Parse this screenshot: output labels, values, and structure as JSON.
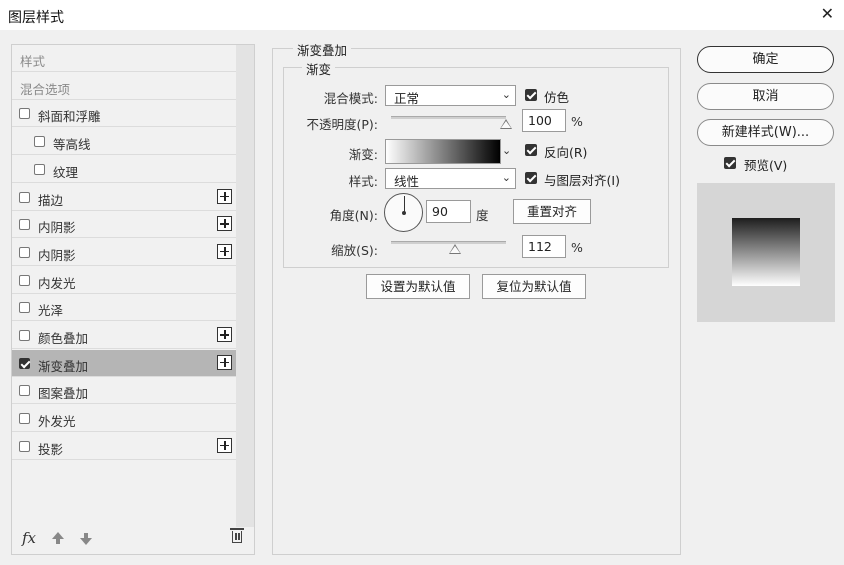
{
  "window": {
    "title": "图层样式"
  },
  "left_list": {
    "items": [
      {
        "label": "样式",
        "checkbox": false,
        "checked": false,
        "plus": false,
        "grey": true,
        "indent": 0
      },
      {
        "label": "混合选项",
        "checkbox": false,
        "checked": false,
        "plus": false,
        "grey": true,
        "indent": 0
      },
      {
        "label": "斜面和浮雕",
        "checkbox": true,
        "checked": false,
        "plus": false,
        "grey": false,
        "indent": 0
      },
      {
        "label": "等高线",
        "checkbox": true,
        "checked": false,
        "plus": false,
        "grey": false,
        "indent": 1
      },
      {
        "label": "纹理",
        "checkbox": true,
        "checked": false,
        "plus": false,
        "grey": false,
        "indent": 1
      },
      {
        "label": "描边",
        "checkbox": true,
        "checked": false,
        "plus": true,
        "grey": false,
        "indent": 0
      },
      {
        "label": "内阴影",
        "checkbox": true,
        "checked": false,
        "plus": true,
        "grey": false,
        "indent": 0
      },
      {
        "label": "内阴影",
        "checkbox": true,
        "checked": false,
        "plus": true,
        "grey": false,
        "indent": 0
      },
      {
        "label": "内发光",
        "checkbox": true,
        "checked": false,
        "plus": false,
        "grey": false,
        "indent": 0
      },
      {
        "label": "光泽",
        "checkbox": true,
        "checked": false,
        "plus": false,
        "grey": false,
        "indent": 0
      },
      {
        "label": "颜色叠加",
        "checkbox": true,
        "checked": false,
        "plus": true,
        "grey": false,
        "indent": 0
      },
      {
        "label": "渐变叠加",
        "checkbox": true,
        "checked": true,
        "plus": true,
        "grey": false,
        "indent": 0,
        "selected": true
      },
      {
        "label": "图案叠加",
        "checkbox": true,
        "checked": false,
        "plus": false,
        "grey": false,
        "indent": 0
      },
      {
        "label": "外发光",
        "checkbox": true,
        "checked": false,
        "plus": false,
        "grey": false,
        "indent": 0
      },
      {
        "label": "投影",
        "checkbox": true,
        "checked": false,
        "plus": true,
        "grey": false,
        "indent": 0
      }
    ],
    "fx_label": "fx"
  },
  "gradient_overlay": {
    "section_title": "渐变叠加",
    "group_title": "渐变",
    "blend_mode_label": "混合模式:",
    "blend_mode_value": "正常",
    "dither_label": "仿色",
    "opacity_label": "不透明度(P):",
    "opacity_value": "100",
    "opacity_unit": "%",
    "opacity_level": 1.0,
    "gradient_label": "渐变:",
    "reverse_label": "反向(R)",
    "style_label": "样式:",
    "style_value": "线性",
    "align_label": "与图层对齐(I)",
    "angle_label": "角度(N):",
    "angle_value": "90",
    "angle_unit": "度",
    "reset_align_button": "重置对齐",
    "scale_label": "缩放(S):",
    "scale_value": "112",
    "scale_unit": "%",
    "scale_level": 0.56,
    "set_default_button": "设置为默认值",
    "reset_default_button": "复位为默认值"
  },
  "right": {
    "ok_button": "确定",
    "cancel_button": "取消",
    "new_style_button": "新建样式(W)...",
    "preview_label": "预览(V)"
  },
  "colors": {
    "selected_row": "#b5b5b5",
    "gradient_start": "#ffffff",
    "gradient_end": "#000000"
  }
}
